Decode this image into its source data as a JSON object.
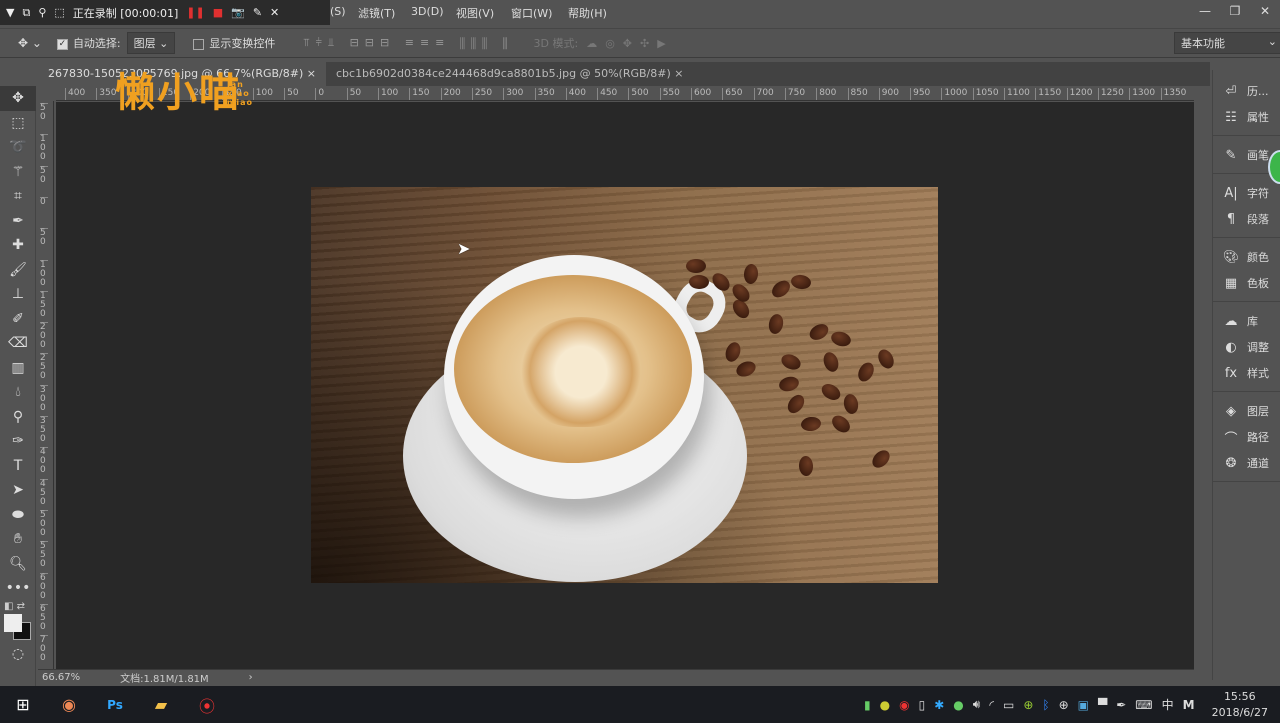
{
  "recorder": {
    "status": "正在录制 [00:00:01]"
  },
  "menu": {
    "items": [
      "(S)",
      "滤镜(T)",
      "3D(D)",
      "视图(V)",
      "窗口(W)",
      "帮助(H)"
    ]
  },
  "window_controls": {
    "minimize": "—",
    "restore": "❐",
    "close": "✕"
  },
  "options": {
    "auto_select_label": "自动选择:",
    "auto_select_checked": true,
    "auto_select_target": "图层",
    "show_transform_label": "显示变换控件",
    "show_transform_checked": false,
    "mode_3d_label": "3D 模式:",
    "workspace": "基本功能"
  },
  "tabs": [
    {
      "label": "267830-1505230P5769.jpg @ 66.7%(RGB/8#)",
      "close": "×"
    },
    {
      "label": "cbc1b6902d0384ce244468d9ca8801b5.jpg @ 50%(RGB/8#)",
      "close": "×"
    }
  ],
  "hruler": [
    "400",
    "350",
    "300",
    "250",
    "200",
    "150",
    "100",
    "50",
    "0",
    "50",
    "100",
    "150",
    "200",
    "250",
    "300",
    "350",
    "400",
    "450",
    "500",
    "550",
    "600",
    "650",
    "700",
    "750",
    "800",
    "850",
    "900",
    "950",
    "1000",
    "1050",
    "1100",
    "1150",
    "1200",
    "1250",
    "1300",
    "1350"
  ],
  "vruler": [
    "50",
    "100",
    "50",
    "0",
    "50",
    "100",
    "150",
    "200",
    "250",
    "300",
    "350",
    "400",
    "450",
    "500",
    "550",
    "600",
    "650",
    "700"
  ],
  "tools": [
    "move",
    "marquee",
    "lasso",
    "magic-wand",
    "crop",
    "eyedropper",
    "healing",
    "brush",
    "stamp",
    "history-brush",
    "eraser",
    "gradient",
    "blur",
    "dodge",
    "pen",
    "type",
    "path-select",
    "ellipse",
    "hand",
    "zoom",
    "more"
  ],
  "panels": [
    {
      "icon": "history",
      "label": "历..."
    },
    {
      "icon": "properties",
      "label": "属性"
    },
    {
      "icon": "brush",
      "label": "画笔"
    },
    {
      "icon": "character",
      "label": "字符"
    },
    {
      "icon": "paragraph",
      "label": "段落"
    },
    {
      "icon": "color",
      "label": "颜色"
    },
    {
      "icon": "swatches",
      "label": "色板"
    },
    {
      "icon": "libraries",
      "label": "库"
    },
    {
      "icon": "adjustments",
      "label": "调整"
    },
    {
      "icon": "styles",
      "label": "样式"
    },
    {
      "icon": "layers",
      "label": "图层"
    },
    {
      "icon": "paths",
      "label": "路径"
    },
    {
      "icon": "channels",
      "label": "通道"
    }
  ],
  "status": {
    "zoom": "66.67%",
    "doc": "文档:1.81M/1.81M"
  },
  "watermark": {
    "text": "懒小喵",
    "sub": "lan xiao miao"
  },
  "tray": {
    "ime": "中",
    "clock_time": "15:56",
    "clock_date": "2018/6/27"
  }
}
